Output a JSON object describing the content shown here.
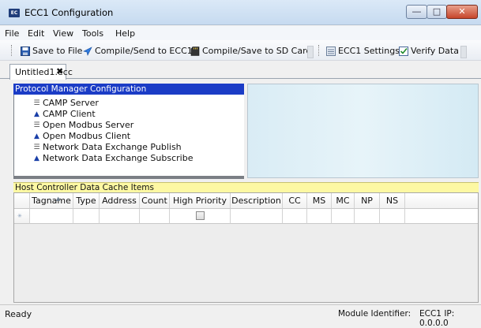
{
  "window": {
    "title": "ECC1 Configuration",
    "icon_text": "EC"
  },
  "menu": [
    "File",
    "Edit",
    "View",
    "Tools",
    "Help"
  ],
  "toolbar": {
    "save_to_file": "Save to File",
    "compile_send": "Compile/Send to ECC1",
    "compile_sd": "Compile/Save to SD Card",
    "ecc1_settings": "ECC1 Settings",
    "verify_data": "Verify Data"
  },
  "document_tab": {
    "label": "Untitled1.ecc",
    "close_glyph": "✖"
  },
  "protocol_manager": {
    "header": "Protocol Manager Configuration",
    "items": [
      {
        "label": "CAMP Server",
        "kind": "server"
      },
      {
        "label": "CAMP Client",
        "kind": "client"
      },
      {
        "label": "Open Modbus Server",
        "kind": "server"
      },
      {
        "label": "Open Modbus Client",
        "kind": "client"
      },
      {
        "label": "Network Data Exchange Publish",
        "kind": "server"
      },
      {
        "label": "Network Data Exchange Subscribe",
        "kind": "client"
      }
    ]
  },
  "cache": {
    "header": "Host Controller Data Cache Items",
    "columns": [
      "Tagname",
      "Type",
      "Address",
      "Count",
      "High Priority",
      "Description",
      "CC",
      "MS",
      "MC",
      "NP",
      "NS"
    ],
    "new_row": {
      "high_priority": false
    }
  },
  "status": {
    "ready": "Ready",
    "module_identifier": "Module Identifier:",
    "ip": "ECC1 IP: 0.0.0.0"
  },
  "colors": {
    "pm_header_bg": "#1b3cc6",
    "cache_header_bg": "#fdf8a3",
    "close_button": "#c7452a"
  }
}
